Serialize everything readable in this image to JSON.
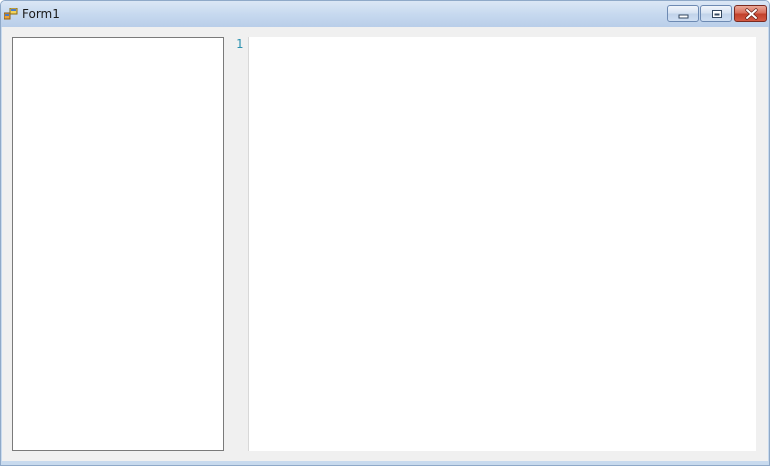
{
  "window": {
    "title": "Form1",
    "icon": "windows-form-icon",
    "controls": {
      "minimize": "minimize-icon",
      "maximize": "restore-icon",
      "close": "close-icon"
    }
  },
  "editor": {
    "line_numbers": [
      "1"
    ],
    "content": ""
  },
  "colors": {
    "titlebar": "#c7d9ef",
    "client_background": "#f0f0f0",
    "line_number": "#2b91af",
    "close_button": "#c2412b"
  }
}
